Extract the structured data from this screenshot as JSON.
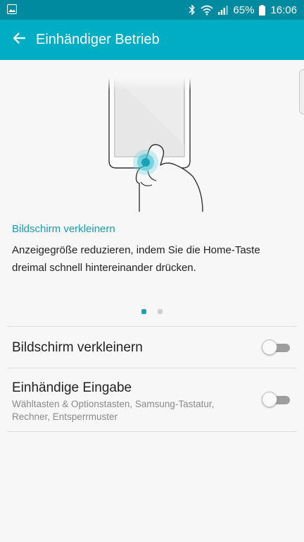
{
  "status_bar": {
    "battery_percent": "65%",
    "time": "16:06",
    "icons": [
      "image-icon",
      "bluetooth-icon",
      "wifi-icon",
      "signal-icon",
      "battery-icon"
    ]
  },
  "app_bar": {
    "title": "Einhändiger Betrieb",
    "background_color": "#00aec4",
    "back_icon": "arrow-back-icon"
  },
  "intro": {
    "heading": "Bildschirm verkleinern",
    "description": "Anzeigegröße reduzieren, indem Sie die Home-Taste dreimal schnell hintereinander drücken.",
    "page_indicator": {
      "current": 1,
      "total": 2
    }
  },
  "settings": [
    {
      "title": "Bildschirm verkleinern",
      "subtitle": "",
      "enabled": false
    },
    {
      "title": "Einhändige Eingabe",
      "subtitle": "Wähltasten & Optionstasten, Samsung-Tastatur, Rechner, Entsperrmuster",
      "enabled": false
    }
  ],
  "accent_color": "#1a9bb0"
}
